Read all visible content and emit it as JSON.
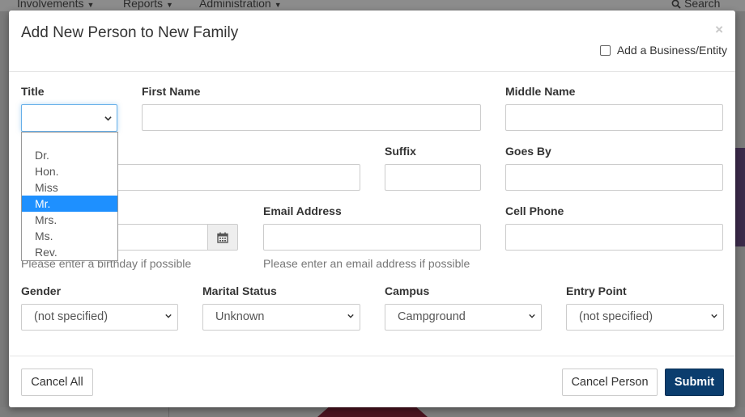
{
  "background": {
    "nav": [
      {
        "label": "Involvements"
      },
      {
        "label": "Reports"
      },
      {
        "label": "Administration"
      }
    ],
    "search_label": "Search"
  },
  "modal": {
    "title": "Add New Person to New Family",
    "close_glyph": "×",
    "business_checkbox_label": "Add a Business/Entity"
  },
  "form": {
    "title_label": "Title",
    "title_options": [
      "Dr.",
      "Hon.",
      "Miss",
      "Mr.",
      "Mrs.",
      "Ms.",
      "Rev."
    ],
    "title_highlighted": "Mr.",
    "first_name_label": "First Name",
    "middle_name_label": "Middle Name",
    "suffix_label": "Suffix",
    "goes_by_label": "Goes By",
    "email_label": "Email Address",
    "cell_phone_label": "Cell Phone",
    "birthday_help": "Please enter a birthday if possible",
    "email_help": "Please enter an email address if possible",
    "gender_label": "Gender",
    "gender_value": "(not specified)",
    "marital_label": "Marital Status",
    "marital_value": "Unknown",
    "campus_label": "Campus",
    "campus_value": "Campground",
    "entry_label": "Entry Point",
    "entry_value": "(not specified)"
  },
  "footer": {
    "cancel_all": "Cancel All",
    "cancel_person": "Cancel Person",
    "submit": "Submit"
  },
  "colors": {
    "primary_button": "#0b3d6e",
    "dropdown_highlight": "#1e90ff",
    "focus_border": "#66afe9"
  }
}
